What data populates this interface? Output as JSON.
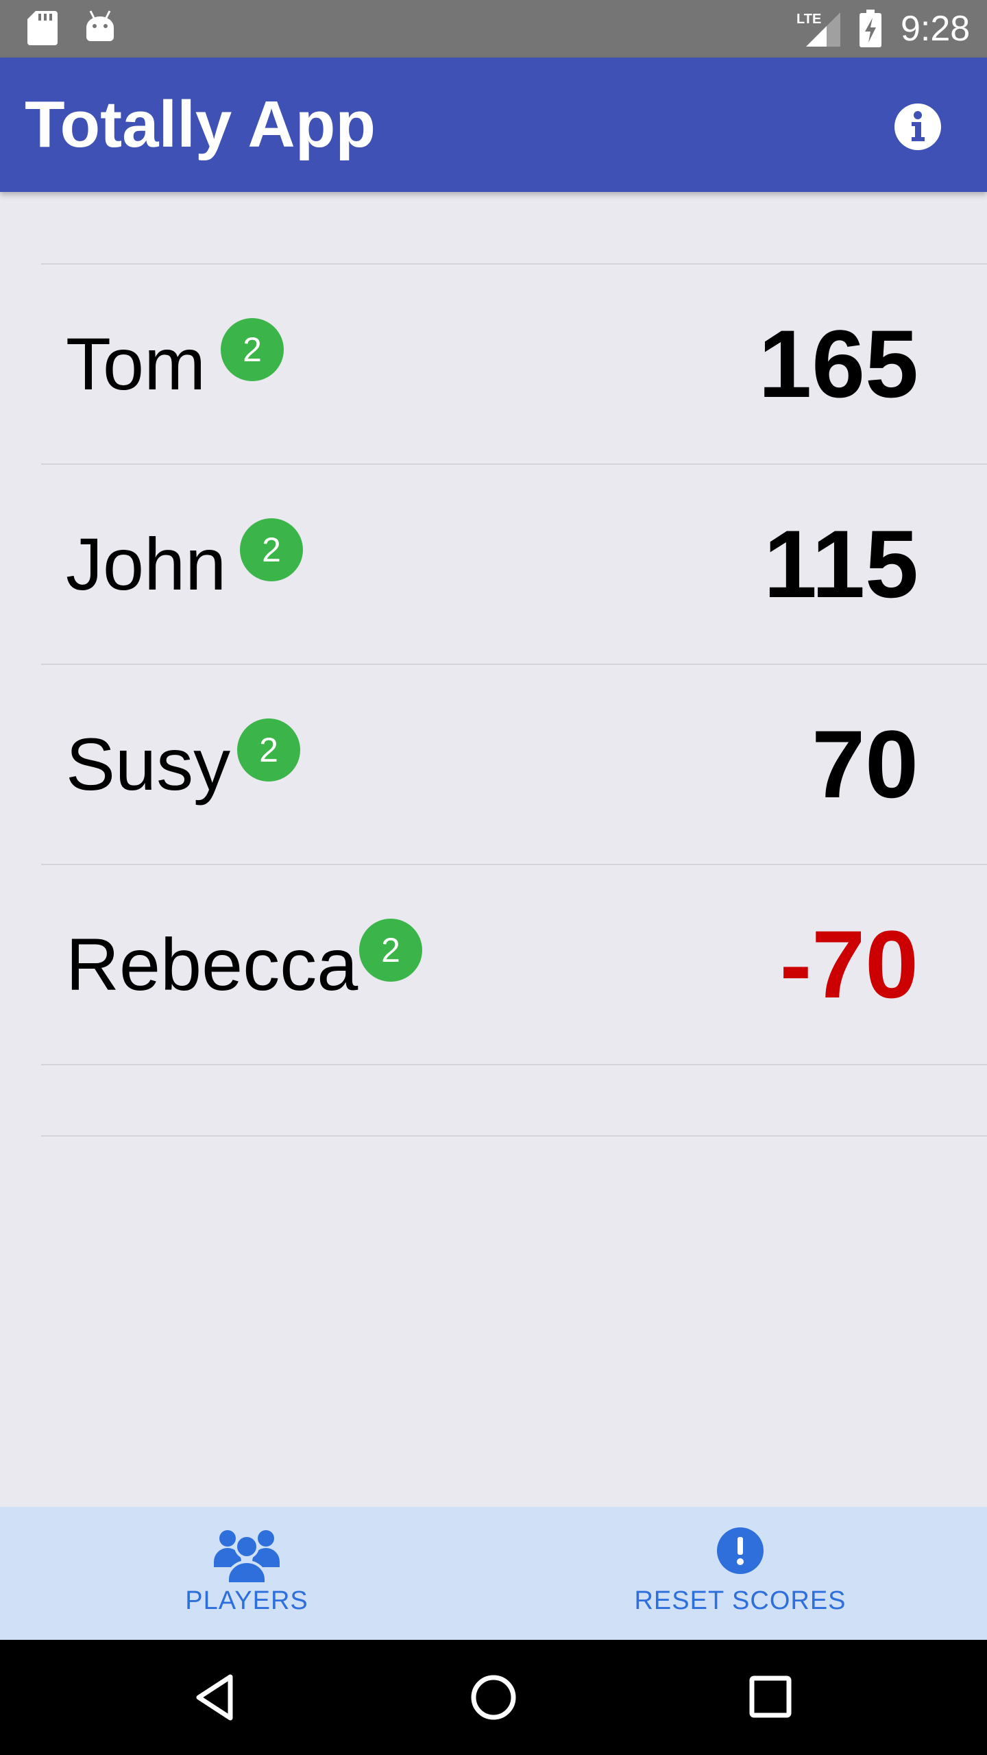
{
  "status_bar": {
    "time": "9:28",
    "network_label": "LTE",
    "icons": [
      "sd-card-icon",
      "android-icon",
      "lte-signal-icon",
      "battery-charging-icon"
    ]
  },
  "app_bar": {
    "title": "Totally App",
    "action_icon": "info-icon",
    "background": "#3f51b5"
  },
  "players": [
    {
      "name": "Tom",
      "badge": "2",
      "score": "165",
      "negative": false
    },
    {
      "name": "John",
      "badge": "2",
      "score": "115",
      "negative": false
    },
    {
      "name": "Susy",
      "badge": "2",
      "score": "70",
      "negative": false
    },
    {
      "name": "Rebecca",
      "badge": "2",
      "score": "-70",
      "negative": true
    }
  ],
  "colors": {
    "badge": "#3bb54a",
    "negative_score": "#cc0000",
    "accent": "#2e6fdc"
  },
  "bottom_nav": {
    "items": [
      {
        "label": "PLAYERS",
        "icon": "players-icon"
      },
      {
        "label": "RESET SCORES",
        "icon": "alert-icon"
      }
    ]
  },
  "system_nav": {
    "icons": [
      "back-icon",
      "home-icon",
      "recents-icon"
    ]
  }
}
